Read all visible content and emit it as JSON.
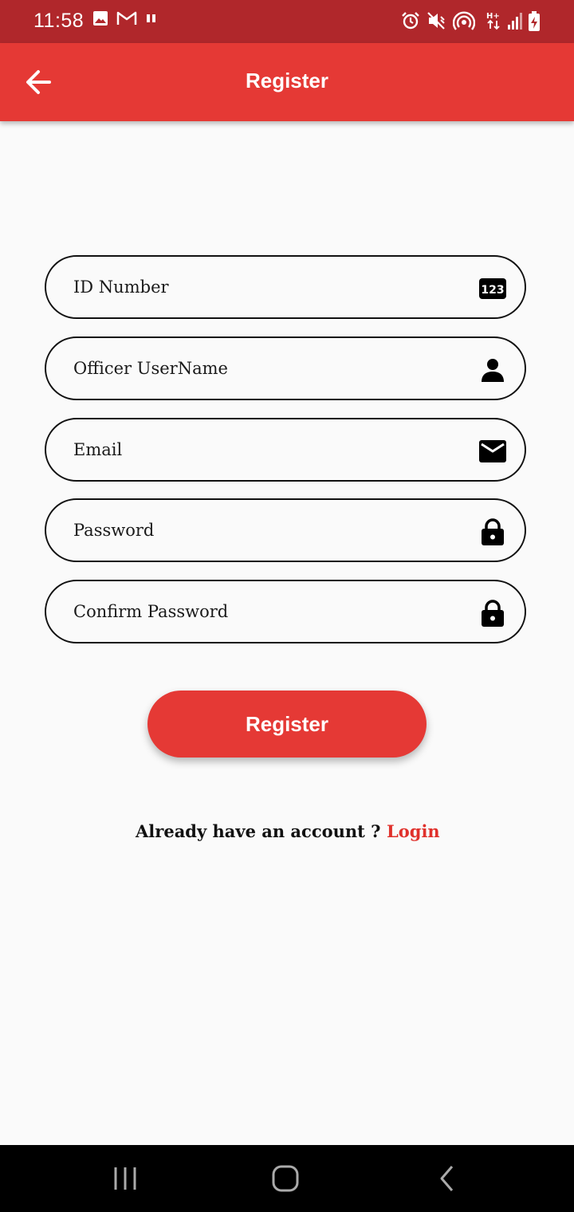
{
  "status_bar": {
    "time": "11:58",
    "left_icons": [
      "gallery-icon",
      "gmail-icon",
      "pause-icon"
    ],
    "right_icons": [
      "alarm-icon",
      "vibrate-mute-icon",
      "hotspot-icon",
      "data-arrows-icon",
      "signal-icon",
      "battery-charging-icon"
    ],
    "background": "#b0272b"
  },
  "app_bar": {
    "title": "Register",
    "back_icon": "arrow-left-icon",
    "background": "#e53935"
  },
  "form": {
    "fields": [
      {
        "placeholder": "ID Number",
        "icon": "numbers-123-icon"
      },
      {
        "placeholder": "Officer UserName",
        "icon": "person-icon"
      },
      {
        "placeholder": "Email",
        "icon": "mail-icon"
      },
      {
        "placeholder": "Password",
        "icon": "lock-icon"
      },
      {
        "placeholder": "Confirm Password",
        "icon": "lock-icon"
      }
    ],
    "submit_label": "Register"
  },
  "footer": {
    "prompt": "Already have an account ?",
    "login_label": "Login",
    "link_color": "#e0312c"
  },
  "nav_bar": {
    "buttons": [
      "recent-apps-icon",
      "home-icon",
      "back-icon"
    ]
  }
}
